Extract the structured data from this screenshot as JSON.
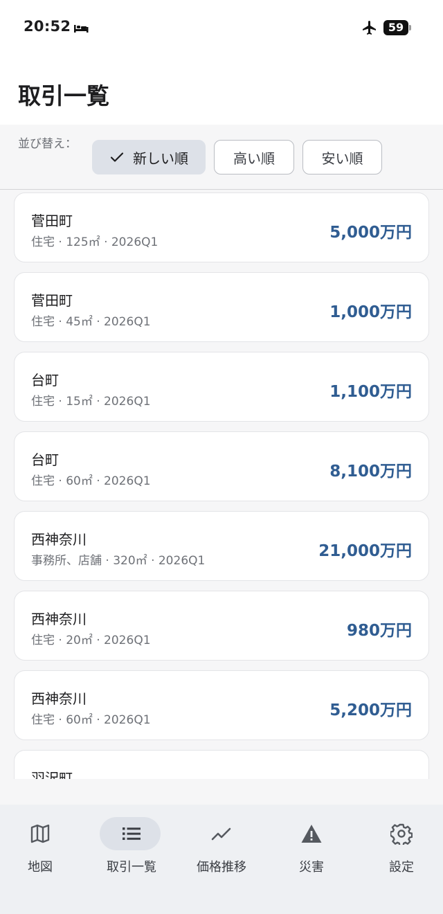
{
  "status_bar": {
    "time": "20:52",
    "battery": "59"
  },
  "header": {
    "title": "取引一覧"
  },
  "sort": {
    "label": "並び替え：",
    "options": [
      {
        "label": "新しい順",
        "selected": true
      },
      {
        "label": "高い順",
        "selected": false
      },
      {
        "label": "安い順",
        "selected": false
      }
    ]
  },
  "transactions": [
    {
      "name": "菅田町",
      "details": "住宅 · 125㎡ · 2026Q1",
      "price": "5,000万円"
    },
    {
      "name": "菅田町",
      "details": "住宅 · 45㎡ · 2026Q1",
      "price": "1,000万円"
    },
    {
      "name": "台町",
      "details": "住宅 · 15㎡ · 2026Q1",
      "price": "1,100万円"
    },
    {
      "name": "台町",
      "details": "住宅 · 60㎡ · 2026Q1",
      "price": "8,100万円"
    },
    {
      "name": "西神奈川",
      "details": "事務所、店舗 · 320㎡ · 2026Q1",
      "price": "21,000万円"
    },
    {
      "name": "西神奈川",
      "details": "住宅 · 20㎡ · 2026Q1",
      "price": "980万円"
    },
    {
      "name": "西神奈川",
      "details": "住宅 · 60㎡ · 2026Q1",
      "price": "5,200万円"
    },
    {
      "name": "羽沢町",
      "details": "",
      "price": ""
    }
  ],
  "nav": {
    "items": [
      {
        "label": "地図",
        "icon": "map-icon"
      },
      {
        "label": "取引一覧",
        "icon": "list-icon",
        "active": true
      },
      {
        "label": "価格推移",
        "icon": "trend-icon"
      },
      {
        "label": "災害",
        "icon": "warning-icon"
      },
      {
        "label": "設定",
        "icon": "gear-icon"
      }
    ]
  },
  "colors": {
    "price": "#305d92",
    "active_pill": "#dde1e8",
    "nav_bg": "#eef0f3"
  }
}
